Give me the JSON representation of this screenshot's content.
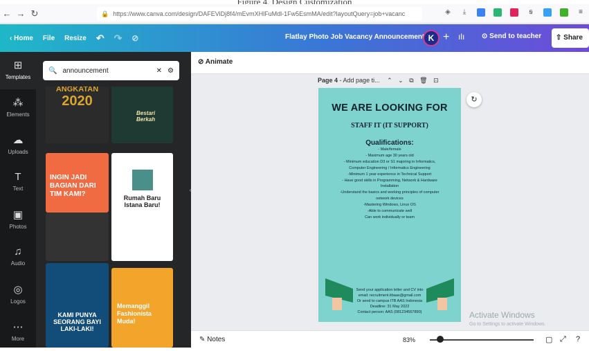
{
  "caption": "Figure 4. Design Customization",
  "browser": {
    "url": "https://www.canva.com/design/DAFEViDj8f4/mEvmXHlFuMdl-1Fw5EsmMA/edit?layoutQuery=job+vacanc"
  },
  "toolbar": {
    "home": "Home",
    "file": "File",
    "resize": "Resize",
    "title": "Flatlay Photo Job Vacancy Announcement",
    "avatar": "K",
    "send": "Send to teacher",
    "share": "Share"
  },
  "rail": [
    "Templates",
    "Elements",
    "Uploads",
    "Text",
    "Photos",
    "Audio",
    "Logos",
    "More"
  ],
  "search": {
    "value": "announcement"
  },
  "thumbs": {
    "t1a": "ANGKATAN",
    "t1b": "2020",
    "t2": "Bestari Berkah",
    "t3": "INGIN JADI BAGIAN DARI TIM KAMI?",
    "t4": "Rumah Baru Istana Baru!",
    "t5": "KAMI PUNYA SEORANG BAYI LAKI-LAKI!",
    "t6": "Memanggil Fashionista Muda!"
  },
  "canvas": {
    "animate": "Animate",
    "page_label": "Page 4",
    "page_title_placeholder": " - Add page ti..."
  },
  "poster": {
    "title": "WE ARE LOOKING FOR",
    "subtitle": "STAFF IT (IT SUPPORT)",
    "qual_head": "Qualifications:",
    "quals": [
      "- Male/female",
      "- Maximum age 30 years old",
      "- Minimum education D3 or S1 majoring in Informatics,",
      "Computer Engineering / Informatics Engineering",
      "-Minimum 1 year experience in Technical Support",
      "- Have good skills in Programming, Network & Hardware",
      "Installation",
      "-Understand the basics and working principles of computer",
      "network devices",
      "-Mastering Windows, Linux OS",
      "-Able to communicate well",
      "Can work individually or team"
    ],
    "footer": [
      "Send your application letter and CV into",
      "email: recruitment.itbaas@gmail.com",
      "Or send to campus ITB AAS Indonesia",
      "Deadline: 31 May 2022",
      "Contact person: AAS (081234567890)"
    ]
  },
  "bottom": {
    "notes": "Notes",
    "zoom": "83%"
  },
  "watermark": {
    "line1": "Activate Windows",
    "line2": "Go to Settings to activate Windows."
  }
}
